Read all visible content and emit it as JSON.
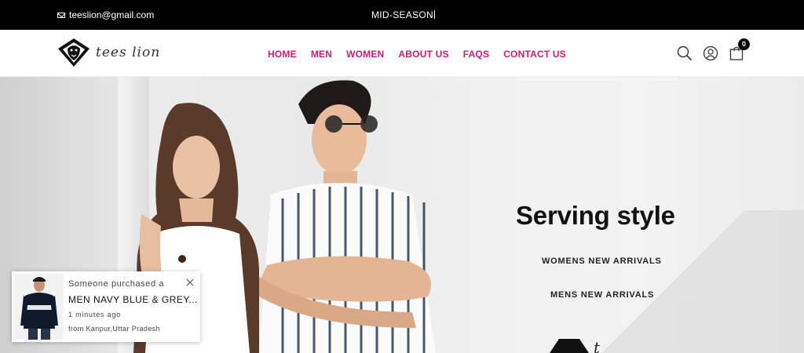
{
  "topbar": {
    "email": "teeslion@gmail.com",
    "promo": "MID-SEASON"
  },
  "header": {
    "logo_text": "tees lion",
    "nav": [
      "HOME",
      "MEN",
      "WOMEN",
      "ABOUT US",
      "FAQS",
      "CONTACT US"
    ],
    "cart_count": "0"
  },
  "hero": {
    "title": "Serving style",
    "link_women": "WOMENS NEW ARRIVALS",
    "link_men": "MENS NEW ARRIVALS"
  },
  "popup": {
    "line1": "Someone purchased a",
    "product": "MEN NAVY BLUE & GREY...",
    "time": "1 minutes ago",
    "location": "from Kanpur,Uttar Pradesh"
  },
  "colors": {
    "nav_accent": "#d1187a",
    "topbar_bg": "#000000"
  }
}
